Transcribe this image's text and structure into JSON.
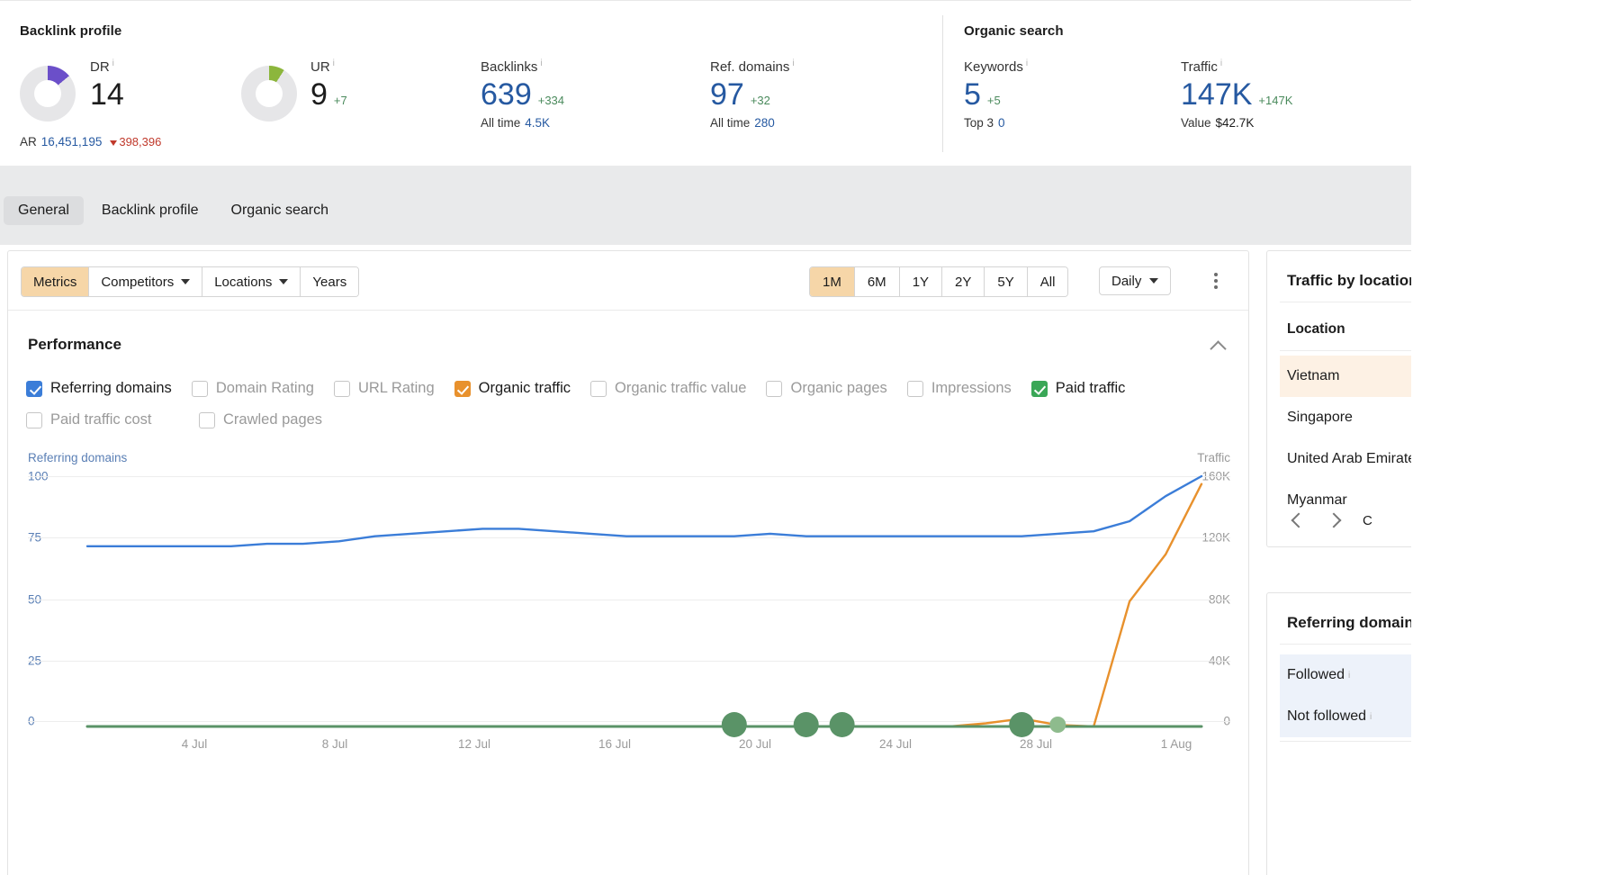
{
  "metrics": {
    "backlink_profile": {
      "group_title": "Backlink profile",
      "items": [
        {
          "label": "DR",
          "value": "14",
          "delta": "",
          "sub_label": "AR",
          "sub_value": "16,451,195",
          "sub_delta": "398,396",
          "gauge_pct": 14,
          "gauge_color": "#6b4fc9"
        },
        {
          "label": "UR",
          "value": "9",
          "delta": "+7",
          "gauge_pct": 9,
          "gauge_color": "#8cb63c"
        },
        {
          "label": "Backlinks",
          "value": "639",
          "delta": "+334",
          "sub_label": "All time",
          "sub_value": "4.5K"
        },
        {
          "label": "Ref. domains",
          "value": "97",
          "delta": "+32",
          "sub_label": "All time",
          "sub_value": "280"
        }
      ]
    },
    "organic_search": {
      "group_title": "Organic search",
      "items": [
        {
          "label": "Keywords",
          "value": "5",
          "delta": "+5",
          "sub_label": "Top 3",
          "sub_value": "0"
        },
        {
          "label": "Traffic",
          "value": "147K",
          "delta": "+147K",
          "sub_label": "Value",
          "sub_value": "$42.7K"
        }
      ]
    }
  },
  "tabs": [
    {
      "label": "General",
      "active": true
    },
    {
      "label": "Backlink profile",
      "active": false
    },
    {
      "label": "Organic search",
      "active": false
    }
  ],
  "toolbar": {
    "left_buttons": [
      {
        "label": "Metrics",
        "selected": true,
        "has_caret": false
      },
      {
        "label": "Competitors",
        "selected": false,
        "has_caret": true
      },
      {
        "label": "Locations",
        "selected": false,
        "has_caret": true
      },
      {
        "label": "Years",
        "selected": false,
        "has_caret": false
      }
    ],
    "ranges": [
      {
        "label": "1M",
        "selected": true
      },
      {
        "label": "6M",
        "selected": false
      },
      {
        "label": "1Y",
        "selected": false
      },
      {
        "label": "2Y",
        "selected": false
      },
      {
        "label": "5Y",
        "selected": false
      },
      {
        "label": "All",
        "selected": false
      }
    ],
    "granularity": "Daily",
    "more_menu": "more-options"
  },
  "performance": {
    "title": "Performance",
    "legend": [
      {
        "label": "Referring domains",
        "checked": true,
        "color": "#3b7dd8"
      },
      {
        "label": "Domain Rating",
        "checked": false,
        "color": "#c6c6c6"
      },
      {
        "label": "URL Rating",
        "checked": false,
        "color": "#c6c6c6"
      },
      {
        "label": "Organic traffic",
        "checked": true,
        "color": "#e8912d"
      },
      {
        "label": "Organic traffic value",
        "checked": false,
        "color": "#c6c6c6"
      },
      {
        "label": "Organic pages",
        "checked": false,
        "color": "#c6c6c6"
      },
      {
        "label": "Impressions",
        "checked": false,
        "color": "#c6c6c6"
      },
      {
        "label": "Paid traffic",
        "checked": true,
        "color": "#3aa757"
      },
      {
        "label": "Paid traffic cost",
        "checked": false,
        "color": "#c6c6c6"
      },
      {
        "label": "Crawled pages",
        "checked": false,
        "color": "#c6c6c6"
      }
    ]
  },
  "chart_data": {
    "type": "line",
    "title": "Performance",
    "left_axis_name": "Referring domains",
    "right_axis_name": "Traffic",
    "left_ticks": [
      "100",
      "75",
      "50",
      "25",
      "0"
    ],
    "right_ticks": [
      "160K",
      "120K",
      "80K",
      "40K",
      "0"
    ],
    "ylim_left": [
      0,
      100
    ],
    "ylim_right": [
      0,
      160000
    ],
    "x_ticks": [
      "4 Jul",
      "8 Jul",
      "12 Jul",
      "16 Jul",
      "20 Jul",
      "24 Jul",
      "28 Jul",
      "1 Aug"
    ],
    "xlabel": "",
    "ylabel": "Referring domains",
    "grid": true,
    "legend_position": "top",
    "series": [
      {
        "name": "Referring domains",
        "axis": "left",
        "color": "#3b7dd8",
        "x": [
          1,
          2,
          3,
          4,
          5,
          6,
          7,
          8,
          9,
          10,
          11,
          12,
          13,
          14,
          15,
          16,
          17,
          18,
          19,
          20,
          21,
          22,
          23,
          24,
          25,
          26,
          27,
          28,
          29,
          30,
          31,
          32
        ],
        "values": [
          72,
          72,
          72,
          72,
          72,
          73,
          73,
          74,
          76,
          77,
          78,
          79,
          79,
          78,
          77,
          76,
          76,
          76,
          76,
          77,
          76,
          76,
          76,
          76,
          76,
          76,
          76,
          77,
          78,
          82,
          92,
          100
        ]
      },
      {
        "name": "Organic traffic",
        "axis": "right",
        "color": "#e8912d",
        "x": [
          1,
          2,
          3,
          4,
          5,
          6,
          7,
          8,
          9,
          10,
          11,
          12,
          13,
          14,
          15,
          16,
          17,
          18,
          19,
          20,
          21,
          22,
          23,
          24,
          25,
          26,
          27,
          28,
          29,
          30,
          31,
          32
        ],
        "values": [
          0,
          0,
          0,
          0,
          0,
          0,
          0,
          0,
          0,
          0,
          0,
          0,
          0,
          0,
          0,
          0,
          0,
          0,
          0,
          0,
          0,
          0,
          0,
          0,
          0,
          2000,
          5000,
          1000,
          0,
          80000,
          110000,
          155000
        ]
      },
      {
        "name": "Paid traffic",
        "axis": "right",
        "color": "#5a9367",
        "x": [
          1,
          2,
          3,
          4,
          5,
          6,
          7,
          8,
          9,
          10,
          11,
          12,
          13,
          14,
          15,
          16,
          17,
          18,
          19,
          20,
          21,
          22,
          23,
          24,
          25,
          26,
          27,
          28,
          29,
          30,
          31,
          32
        ],
        "values": [
          0,
          0,
          0,
          0,
          0,
          0,
          0,
          0,
          0,
          0,
          0,
          0,
          0,
          0,
          0,
          0,
          0,
          0,
          0,
          0,
          0,
          0,
          0,
          0,
          0,
          0,
          0,
          0,
          0,
          0,
          0,
          0
        ]
      }
    ],
    "markers": [
      {
        "series": "Paid traffic",
        "x": 19,
        "size": "large",
        "color": "#5a9367"
      },
      {
        "series": "Paid traffic",
        "x": 21,
        "size": "large",
        "color": "#5a9367"
      },
      {
        "series": "Paid traffic",
        "x": 22,
        "size": "large",
        "color": "#5a9367"
      },
      {
        "series": "Paid traffic",
        "x": 27,
        "size": "large",
        "color": "#5a9367"
      },
      {
        "series": "Paid traffic",
        "x": 28,
        "size": "small",
        "color": "#8ebb8d"
      }
    ]
  },
  "traffic_by_location": {
    "title": "Traffic by location",
    "column_header": "Location",
    "rows": [
      {
        "name": "Vietnam",
        "highlight": "orange"
      },
      {
        "name": "Singapore",
        "highlight": "none"
      },
      {
        "name": "United Arab Emirates",
        "highlight": "none"
      },
      {
        "name": "Myanmar",
        "highlight": "none"
      }
    ],
    "footer_label": "C"
  },
  "referring_domains": {
    "title": "Referring domains",
    "rows": [
      {
        "name": "Followed",
        "info": true,
        "highlight": "blue"
      },
      {
        "name": "Not followed",
        "info": true,
        "highlight": "blue"
      }
    ]
  }
}
